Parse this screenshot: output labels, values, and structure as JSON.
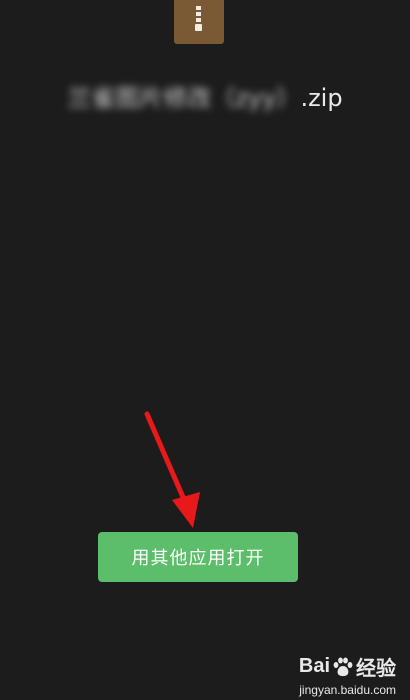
{
  "file": {
    "name_blurred": "兰雀图片修改（zyy）",
    "extension": ".zip"
  },
  "actions": {
    "open_with_other_app": "用其他应用打开"
  },
  "watermark": {
    "brand_left": "Bai",
    "brand_right": "经验",
    "site": "jingyan.baidu.com"
  },
  "colors": {
    "background": "#1c1c1c",
    "zip_icon": "#7a5a34",
    "button": "#5cbd6a",
    "arrow": "#e8191b"
  },
  "icons": {
    "file_icon": "zip-file-icon",
    "annotation": "red-arrow-pointer",
    "watermark_logo": "baidu-paw-logo"
  }
}
